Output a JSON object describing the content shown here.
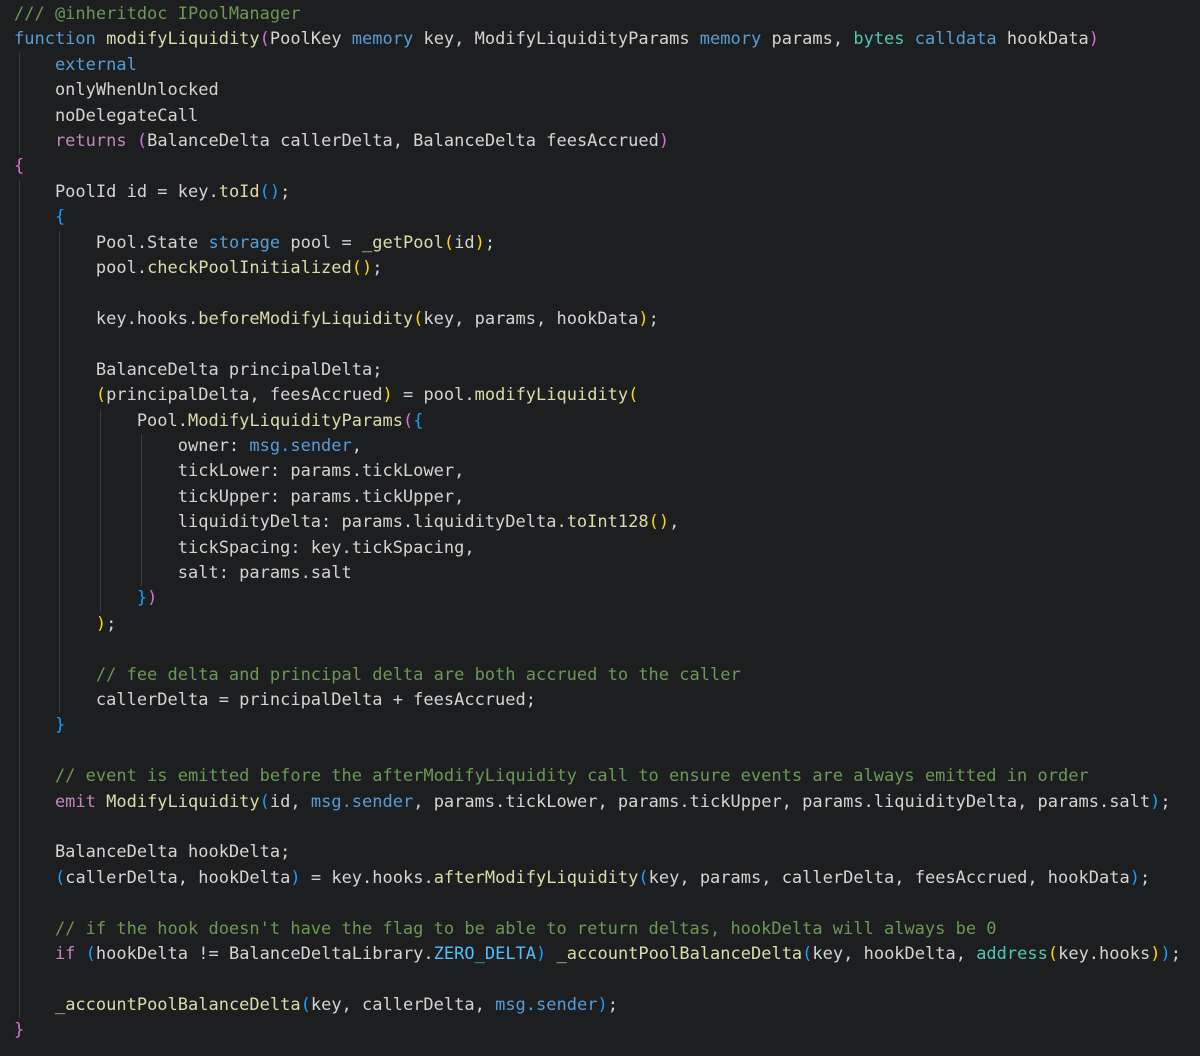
{
  "editor": {
    "background": "#1d1e20",
    "indent_guide_color": "#3a3b3d",
    "language": "solidity",
    "colors": {
      "d": "#d4d4d4",
      "c": "#6a9955",
      "k": "#569cd6",
      "p": "#c586c0",
      "f": "#dcdcaa",
      "t": "#4ec9b0",
      "n": "#4fc1ff",
      "b1": "#ffd700",
      "b2": "#da70d6",
      "b3": "#179fff"
    },
    "lines": [
      {
        "g": 0,
        "t": [
          [
            "c",
            "/// @inheritdoc IPoolManager"
          ]
        ]
      },
      {
        "g": 0,
        "t": [
          [
            "k",
            "function "
          ],
          [
            "f",
            "modifyLiquidity"
          ],
          [
            "b2",
            "("
          ],
          [
            "d",
            "PoolKey "
          ],
          [
            "k",
            "memory"
          ],
          [
            "d",
            " key, ModifyLiquidityParams "
          ],
          [
            "k",
            "memory"
          ],
          [
            "d",
            " params, "
          ],
          [
            "t",
            "bytes"
          ],
          [
            "d",
            " "
          ],
          [
            "k",
            "calldata"
          ],
          [
            "d",
            " hookData"
          ],
          [
            "b2",
            ")"
          ]
        ]
      },
      {
        "g": 1,
        "t": [
          [
            "k",
            "    external"
          ]
        ]
      },
      {
        "g": 1,
        "t": [
          [
            "d",
            "    onlyWhenUnlocked"
          ]
        ]
      },
      {
        "g": 1,
        "t": [
          [
            "d",
            "    noDelegateCall"
          ]
        ]
      },
      {
        "g": 1,
        "t": [
          [
            "p",
            "    returns "
          ],
          [
            "b2",
            "("
          ],
          [
            "d",
            "BalanceDelta callerDelta, BalanceDelta feesAccrued"
          ],
          [
            "b2",
            ")"
          ]
        ]
      },
      {
        "g": 0,
        "t": [
          [
            "b2",
            "{"
          ]
        ]
      },
      {
        "g": 1,
        "t": [
          [
            "d",
            "    PoolId id = key."
          ],
          [
            "f",
            "toId"
          ],
          [
            "b3",
            "()"
          ],
          [
            "d",
            ";"
          ]
        ]
      },
      {
        "g": 1,
        "t": [
          [
            "d",
            "    "
          ],
          [
            "b3",
            "{"
          ]
        ]
      },
      {
        "g": 2,
        "t": [
          [
            "d",
            "        Pool.State "
          ],
          [
            "k",
            "storage"
          ],
          [
            "d",
            " pool = "
          ],
          [
            "f",
            "_getPool"
          ],
          [
            "b1",
            "("
          ],
          [
            "d",
            "id"
          ],
          [
            "b1",
            ")"
          ],
          [
            "d",
            ";"
          ]
        ]
      },
      {
        "g": 2,
        "t": [
          [
            "d",
            "        pool."
          ],
          [
            "f",
            "checkPoolInitialized"
          ],
          [
            "b1",
            "()"
          ],
          [
            "d",
            ";"
          ]
        ]
      },
      {
        "g": 2,
        "t": []
      },
      {
        "g": 2,
        "t": [
          [
            "d",
            "        key.hooks."
          ],
          [
            "f",
            "beforeModifyLiquidity"
          ],
          [
            "b1",
            "("
          ],
          [
            "d",
            "key, params, hookData"
          ],
          [
            "b1",
            ")"
          ],
          [
            "d",
            ";"
          ]
        ]
      },
      {
        "g": 2,
        "t": []
      },
      {
        "g": 2,
        "t": [
          [
            "d",
            "        BalanceDelta principalDelta;"
          ]
        ]
      },
      {
        "g": 2,
        "t": [
          [
            "d",
            "        "
          ],
          [
            "b1",
            "("
          ],
          [
            "d",
            "principalDelta, feesAccrued"
          ],
          [
            "b1",
            ")"
          ],
          [
            "d",
            " = pool."
          ],
          [
            "f",
            "modifyLiquidity"
          ],
          [
            "b1",
            "("
          ]
        ]
      },
      {
        "g": 3,
        "t": [
          [
            "d",
            "            Pool."
          ],
          [
            "f",
            "ModifyLiquidityParams"
          ],
          [
            "b2",
            "("
          ],
          [
            "b3",
            "{"
          ]
        ]
      },
      {
        "g": 4,
        "t": [
          [
            "d",
            "                owner: "
          ],
          [
            "k",
            "msg.sender"
          ],
          [
            "d",
            ","
          ]
        ]
      },
      {
        "g": 4,
        "t": [
          [
            "d",
            "                tickLower: params.tickLower,"
          ]
        ]
      },
      {
        "g": 4,
        "t": [
          [
            "d",
            "                tickUpper: params.tickUpper,"
          ]
        ]
      },
      {
        "g": 4,
        "t": [
          [
            "d",
            "                liquidityDelta: params.liquidityDelta."
          ],
          [
            "f",
            "toInt128"
          ],
          [
            "b1",
            "()"
          ],
          [
            "d",
            ","
          ]
        ]
      },
      {
        "g": 4,
        "t": [
          [
            "d",
            "                tickSpacing: key.tickSpacing,"
          ]
        ]
      },
      {
        "g": 4,
        "t": [
          [
            "d",
            "                salt: params.salt"
          ]
        ]
      },
      {
        "g": 3,
        "t": [
          [
            "d",
            "            "
          ],
          [
            "b3",
            "}"
          ],
          [
            "b2",
            ")"
          ]
        ]
      },
      {
        "g": 2,
        "t": [
          [
            "d",
            "        "
          ],
          [
            "b1",
            ")"
          ],
          [
            "d",
            ";"
          ]
        ]
      },
      {
        "g": 2,
        "t": []
      },
      {
        "g": 2,
        "t": [
          [
            "c",
            "        // fee delta and principal delta are both accrued to the caller"
          ]
        ]
      },
      {
        "g": 2,
        "t": [
          [
            "d",
            "        callerDelta = principalDelta + feesAccrued;"
          ]
        ]
      },
      {
        "g": 1,
        "t": [
          [
            "d",
            "    "
          ],
          [
            "b3",
            "}"
          ]
        ]
      },
      {
        "g": 1,
        "t": []
      },
      {
        "g": 1,
        "t": [
          [
            "c",
            "    // event is emitted before the afterModifyLiquidity call to ensure events are always emitted in order"
          ]
        ]
      },
      {
        "g": 1,
        "t": [
          [
            "p",
            "    emit "
          ],
          [
            "f",
            "ModifyLiquidity"
          ],
          [
            "b3",
            "("
          ],
          [
            "d",
            "id, "
          ],
          [
            "k",
            "msg.sender"
          ],
          [
            "d",
            ", params.tickLower, params.tickUpper, params.liquidityDelta, params.salt"
          ],
          [
            "b3",
            ")"
          ],
          [
            "d",
            ";"
          ]
        ]
      },
      {
        "g": 1,
        "t": []
      },
      {
        "g": 1,
        "t": [
          [
            "d",
            "    BalanceDelta hookDelta;"
          ]
        ]
      },
      {
        "g": 1,
        "t": [
          [
            "d",
            "    "
          ],
          [
            "b3",
            "("
          ],
          [
            "d",
            "callerDelta, hookDelta"
          ],
          [
            "b3",
            ")"
          ],
          [
            "d",
            " = key.hooks."
          ],
          [
            "f",
            "afterModifyLiquidity"
          ],
          [
            "b3",
            "("
          ],
          [
            "d",
            "key, params, callerDelta, feesAccrued, hookData"
          ],
          [
            "b3",
            ")"
          ],
          [
            "d",
            ";"
          ]
        ]
      },
      {
        "g": 1,
        "t": []
      },
      {
        "g": 1,
        "t": [
          [
            "c",
            "    // if the hook doesn't have the flag to be able to return deltas, hookDelta will always be 0"
          ]
        ]
      },
      {
        "g": 1,
        "t": [
          [
            "p",
            "    if "
          ],
          [
            "b3",
            "("
          ],
          [
            "d",
            "hookDelta != BalanceDeltaLibrary."
          ],
          [
            "n",
            "ZERO_DELTA"
          ],
          [
            "b3",
            ")"
          ],
          [
            "d",
            " "
          ],
          [
            "f",
            "_accountPoolBalanceDelta"
          ],
          [
            "b3",
            "("
          ],
          [
            "d",
            "key, hookDelta, "
          ],
          [
            "t",
            "address"
          ],
          [
            "b1",
            "("
          ],
          [
            "d",
            "key.hooks"
          ],
          [
            "b1",
            ")"
          ],
          [
            "b3",
            ")"
          ],
          [
            "d",
            ";"
          ]
        ]
      },
      {
        "g": 1,
        "t": []
      },
      {
        "g": 1,
        "t": [
          [
            "d",
            "    "
          ],
          [
            "f",
            "_accountPoolBalanceDelta"
          ],
          [
            "b3",
            "("
          ],
          [
            "d",
            "key, callerDelta, "
          ],
          [
            "k",
            "msg.sender"
          ],
          [
            "b3",
            ")"
          ],
          [
            "d",
            ";"
          ]
        ]
      },
      {
        "g": 0,
        "t": [
          [
            "b2",
            "}"
          ]
        ]
      }
    ]
  }
}
